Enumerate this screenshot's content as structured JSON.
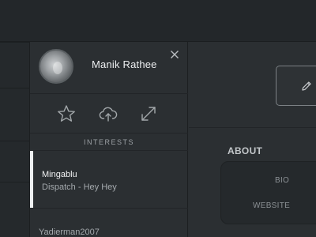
{
  "profile": {
    "name": "Manik Rathee"
  },
  "actions": [
    {
      "icon": "star-icon"
    },
    {
      "icon": "cloud-upload-icon"
    },
    {
      "icon": "expand-icon"
    }
  ],
  "interests": {
    "title": "INTERESTS",
    "items": [
      {
        "title": "Mingablu",
        "subtitle": "Dispatch - Hey Hey",
        "active": true
      },
      {
        "title": "Yadierman2007",
        "subtitle": "",
        "active": false
      }
    ]
  },
  "about": {
    "title": "ABOUT",
    "fields": [
      "BIO",
      "WEBSITE"
    ]
  },
  "colors": {
    "background": "#2a2e31",
    "panel": "#2b2f32",
    "active_bar": "#eef0f1",
    "text_primary": "#eceef0",
    "text_muted": "#a4a9ad"
  }
}
